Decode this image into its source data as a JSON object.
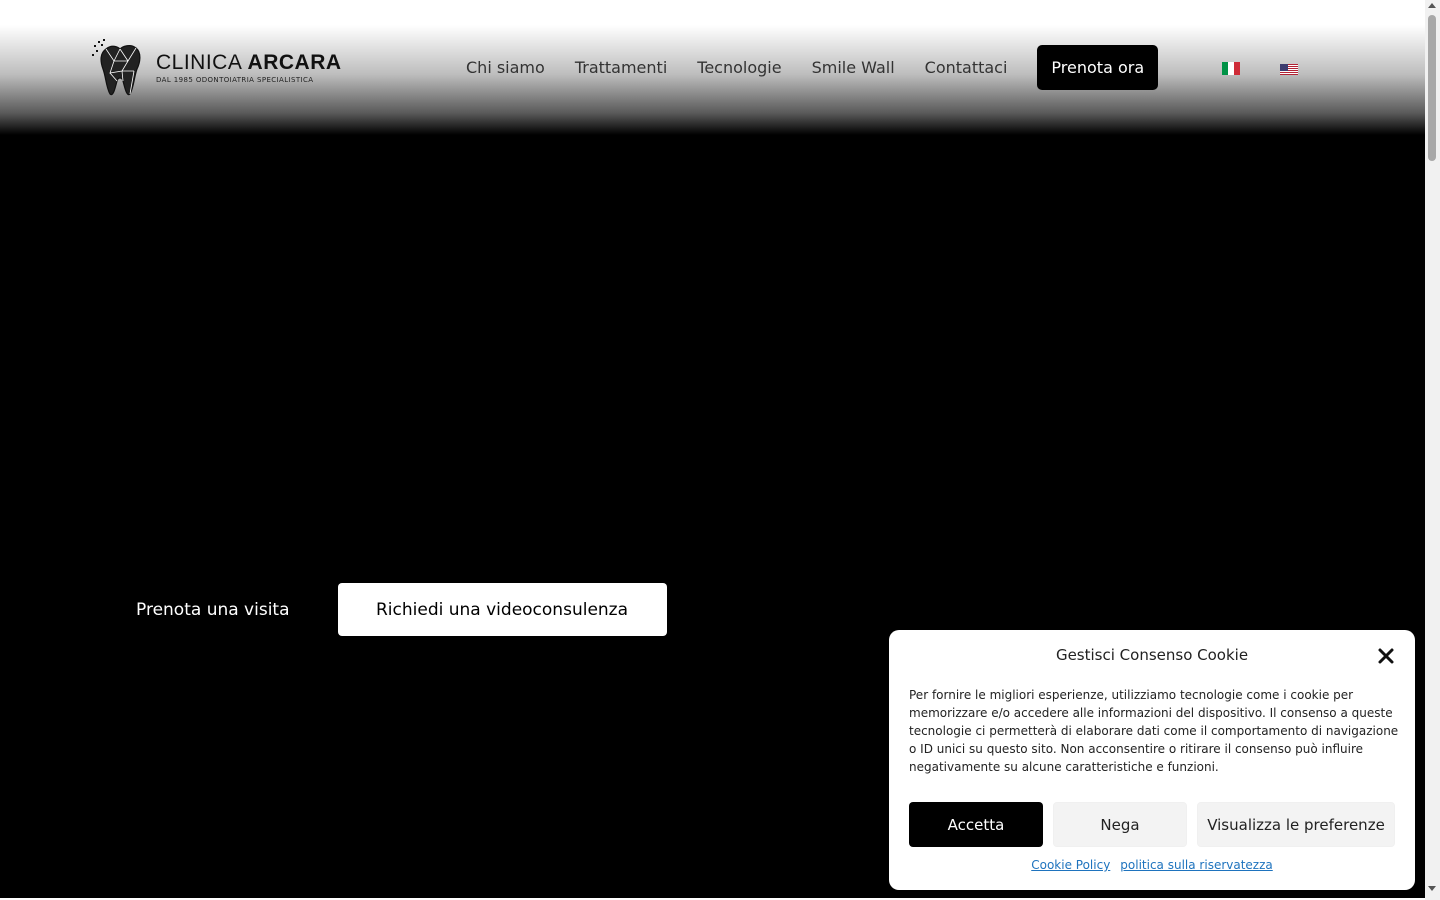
{
  "brand": {
    "name_light": "CLINICA ",
    "name_bold": "ARCARA",
    "tagline": "DAL 1985 ODONTOIATRIA SPECIALISTICA",
    "logo_icon": "tooth-logo-icon"
  },
  "nav": {
    "items": [
      {
        "label": "Chi siamo"
      },
      {
        "label": "Trattamenti"
      },
      {
        "label": "Tecnologie"
      },
      {
        "label": "Smile Wall"
      },
      {
        "label": "Contattaci"
      }
    ],
    "cta_label": "Prenota ora",
    "languages": [
      {
        "code": "it",
        "icon": "flag-italy-icon"
      },
      {
        "code": "en",
        "icon": "flag-usa-icon"
      }
    ]
  },
  "hero": {
    "visit_label": "Prenota una visita",
    "video_label": "Richiedi una videoconsulenza"
  },
  "cookie": {
    "title": "Gestisci Consenso Cookie",
    "body": "Per fornire le migliori esperienze, utilizziamo tecnologie come i cookie per memorizzare e/o accedere alle informazioni del dispositivo. Il consenso a queste tecnologie ci permetterà di elaborare dati come il comportamento di navigazione o ID unici su questo sito. Non acconsentire o ritirare il consenso può influire negativamente su alcune caratteristiche e funzioni.",
    "accept_label": "Accetta",
    "deny_label": "Nega",
    "prefs_label": "Visualizza le preferenze",
    "cookie_policy_label": "Cookie Policy",
    "privacy_label": "politica sulla riservatezza"
  },
  "colors": {
    "accent": "#000000",
    "link": "#1e73be",
    "flag_it": [
      "#009246",
      "#ffffff",
      "#ce2b37"
    ],
    "flag_us_red": "#b22234",
    "flag_us_blue": "#3c3b6e"
  }
}
